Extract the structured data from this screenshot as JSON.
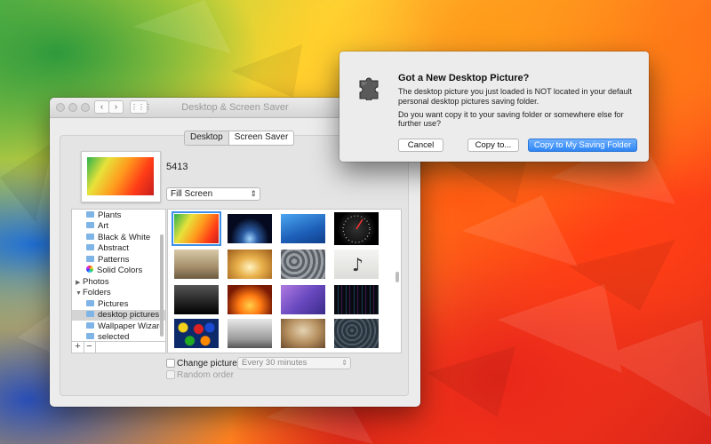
{
  "window": {
    "title": "Desktop & Screen Saver",
    "nav": {
      "back": "‹",
      "forward": "›",
      "grid": "⋮⋮⋮"
    }
  },
  "tabs": [
    {
      "label": "Desktop",
      "active": true
    },
    {
      "label": "Screen Saver",
      "active": false
    }
  ],
  "current_picture": {
    "name": "5413"
  },
  "fill_mode": {
    "value": "Fill Screen"
  },
  "sources": [
    {
      "label": "Plants",
      "kind": "folder"
    },
    {
      "label": "Art",
      "kind": "folder"
    },
    {
      "label": "Black & White",
      "kind": "folder"
    },
    {
      "label": "Abstract",
      "kind": "folder"
    },
    {
      "label": "Patterns",
      "kind": "folder"
    },
    {
      "label": "Solid Colors",
      "kind": "colors"
    },
    {
      "label": "Photos",
      "kind": "group-collapsed"
    },
    {
      "label": "Folders",
      "kind": "group-expanded"
    },
    {
      "label": "Pictures",
      "kind": "folder"
    },
    {
      "label": "desktop pictures",
      "kind": "folder",
      "selected": true
    },
    {
      "label": "Wallpaper Wizard",
      "kind": "folder"
    },
    {
      "label": "selected",
      "kind": "folder"
    }
  ],
  "source_footer": {
    "add": "+",
    "remove": "−"
  },
  "change_picture": {
    "label": "Change picture:",
    "checked": false,
    "interval": "Every 30 minutes"
  },
  "random_order": {
    "label": "Random order",
    "checked": false,
    "enabled": false
  },
  "help": {
    "label": "?"
  },
  "alert": {
    "title": "Got a New Desktop Picture?",
    "message1": "The desktop picture you just loaded is NOT located in your default personal desktop pictures saving folder.",
    "message2": "Do you want copy it to your saving folder or somewhere else for further use?",
    "buttons": {
      "cancel": "Cancel",
      "copy_to": "Copy to...",
      "copy_saving": "Copy to My Saving Folder"
    }
  },
  "colors": {
    "accent": "#2f86f4",
    "selection": "#3d8ee6"
  }
}
